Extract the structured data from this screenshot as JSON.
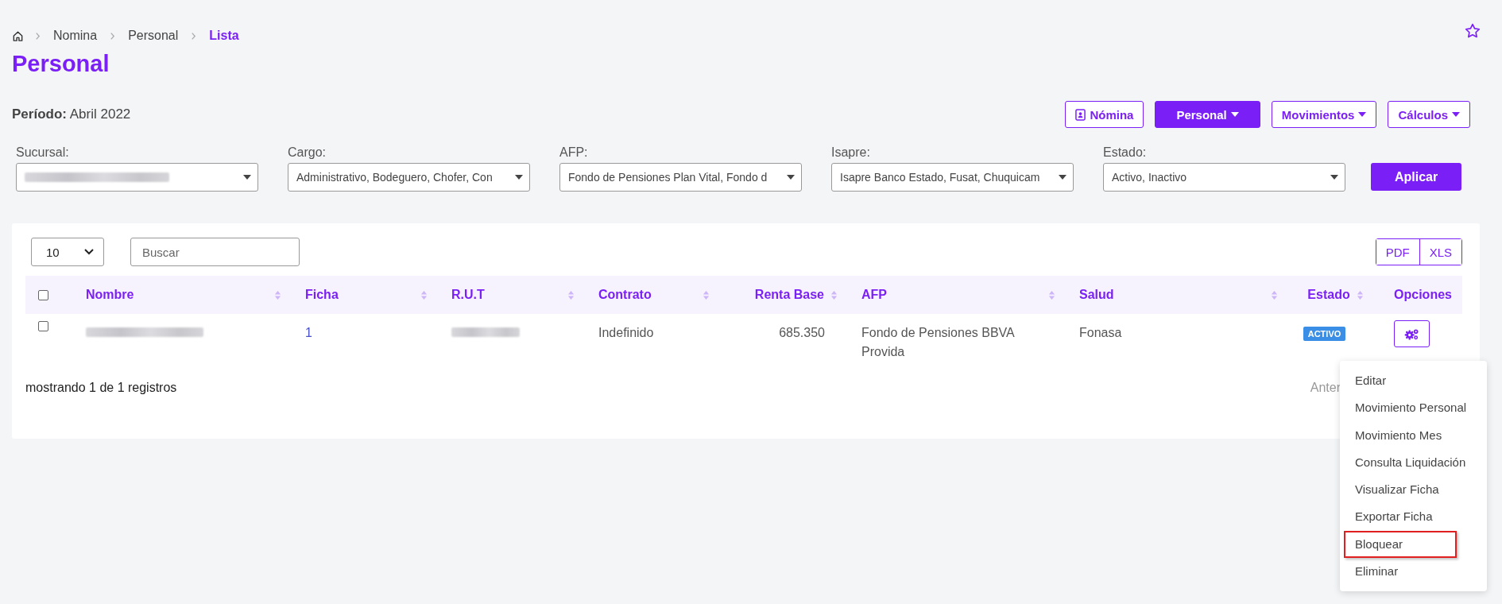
{
  "breadcrumb": [
    {
      "label": "Nomina",
      "current": false
    },
    {
      "label": "Personal",
      "current": false
    },
    {
      "label": "Lista",
      "current": true
    }
  ],
  "title": "Personal",
  "period": {
    "label": "Período:",
    "value": "Abril 2022"
  },
  "actions": [
    {
      "label": "Nómina",
      "kind": "icon",
      "selected": false
    },
    {
      "label": "Personal",
      "kind": "dropdown",
      "selected": true
    },
    {
      "label": "Movimientos",
      "kind": "dropdown",
      "selected": false
    },
    {
      "label": "Cálculos",
      "kind": "dropdown",
      "selected": false
    }
  ],
  "filters": [
    {
      "label": "Sucursal:",
      "redacted": true
    },
    {
      "label": "Cargo:",
      "value": "Administrativo, Bodeguero, Chofer, Con"
    },
    {
      "label": "AFP:",
      "value": "Fondo de Pensiones Plan Vital, Fondo d"
    },
    {
      "label": "Isapre:",
      "value": "Isapre Banco Estado, Fusat, Chuquicam"
    },
    {
      "label": "Estado:",
      "value": "Activo, Inactivo"
    }
  ],
  "apply_button": "Aplicar",
  "table": {
    "page_size": "10",
    "search": {
      "placeholder": "Buscar"
    },
    "exports": [
      "PDF",
      "XLS"
    ],
    "select_all_checked": false,
    "columns": [
      {
        "label": "Nombre",
        "sortable": true
      },
      {
        "label": "Ficha",
        "sortable": true
      },
      {
        "label": "R.U.T",
        "sortable": true
      },
      {
        "label": "Contrato",
        "sortable": true
      },
      {
        "label": "Renta Base",
        "sortable": true
      },
      {
        "label": "AFP",
        "sortable": true
      },
      {
        "label": "Salud",
        "sortable": true
      },
      {
        "label": "Estado",
        "sortable": true
      },
      {
        "label": "Opciones",
        "sortable": false
      }
    ],
    "rows": [
      {
        "checked": false,
        "cells": [
          {
            "kind": "redacted"
          },
          {
            "kind": "link",
            "text": "1"
          },
          {
            "kind": "redacted"
          },
          {
            "kind": "text",
            "text": "Indefinido"
          },
          {
            "kind": "number",
            "text": "685.350"
          },
          {
            "kind": "text",
            "text": "Fondo de Pensiones BBVA Provida"
          },
          {
            "kind": "text",
            "text": "Fonasa"
          },
          {
            "kind": "badge",
            "text": "ACTIVO"
          },
          {
            "kind": "options"
          }
        ]
      }
    ],
    "footer": "mostrando 1 de 1 registros",
    "pagination": "Anter"
  },
  "options_menu": {
    "items": [
      {
        "label": "Editar",
        "highlighted": false
      },
      {
        "label": "Movimiento Personal",
        "highlighted": false
      },
      {
        "label": "Movimiento Mes",
        "highlighted": false
      },
      {
        "label": "Consulta Liquidación",
        "highlighted": false
      },
      {
        "label": "Visualizar Ficha",
        "highlighted": false
      },
      {
        "label": "Exportar Ficha",
        "highlighted": false
      },
      {
        "label": "Bloquear",
        "highlighted": true
      },
      {
        "label": "Eliminar",
        "highlighted": false
      }
    ]
  }
}
